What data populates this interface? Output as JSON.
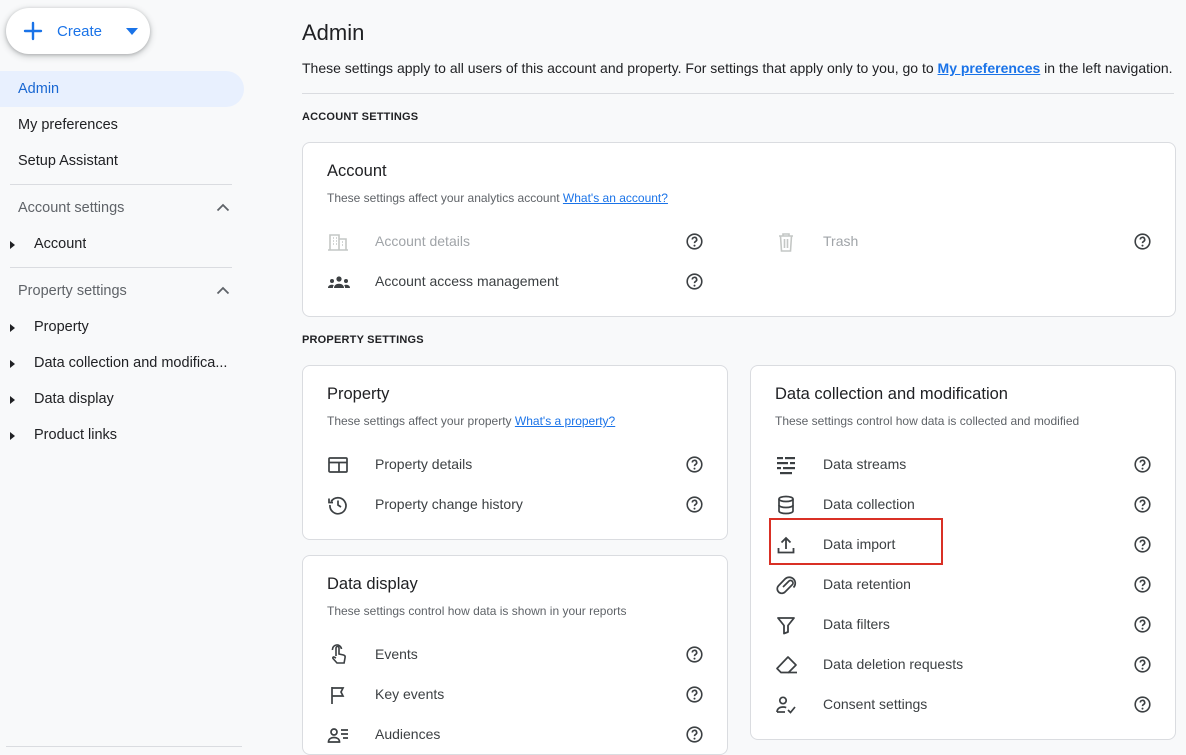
{
  "sidebar": {
    "create_label": "Create",
    "admin": "Admin",
    "my_preferences": "My preferences",
    "setup_assistant": "Setup Assistant",
    "account_settings_heading": "Account settings",
    "account_item": "Account",
    "property_settings_heading": "Property settings",
    "property_items": [
      "Property",
      "Data collection and modifica...",
      "Data display",
      "Product links"
    ]
  },
  "main": {
    "title": "Admin",
    "intro_text": "These settings apply to all users of this account and property. For settings that apply only to you, go to",
    "intro_link": "My preferences",
    "intro_suffix": "in the left navigation.",
    "account_settings_label": "ACCOUNT SETTINGS",
    "property_settings_label": "PROPERTY SETTINGS"
  },
  "cards": {
    "account": {
      "title": "Account",
      "subtitle": "These settings affect your analytics account",
      "link": "What's an account?",
      "rows": [
        {
          "label": "Account details",
          "icon": "building-icon",
          "disabled": true
        },
        {
          "label": "Trash",
          "icon": "trash-icon",
          "disabled": true
        },
        {
          "label": "Account access management",
          "icon": "group-icon",
          "disabled": false
        }
      ]
    },
    "property": {
      "title": "Property",
      "subtitle": "These settings affect your property",
      "link": "What's a property?",
      "rows": [
        {
          "label": "Property details",
          "icon": "web-icon"
        },
        {
          "label": "Property change history",
          "icon": "history-icon"
        }
      ]
    },
    "data_display": {
      "title": "Data display",
      "subtitle": "These settings control how data is shown in your reports",
      "rows": [
        {
          "label": "Events",
          "icon": "touch-icon"
        },
        {
          "label": "Key events",
          "icon": "flag-icon"
        },
        {
          "label": "Audiences",
          "icon": "audience-icon"
        }
      ]
    },
    "data_collection": {
      "title": "Data collection and modification",
      "subtitle": "These settings control how data is collected and modified",
      "rows": [
        {
          "label": "Data streams",
          "icon": "streams-icon"
        },
        {
          "label": "Data collection",
          "icon": "database-icon"
        },
        {
          "label": "Data import",
          "icon": "upload-icon"
        },
        {
          "label": "Data retention",
          "icon": "retention-icon"
        },
        {
          "label": "Data filters",
          "icon": "filter-icon"
        },
        {
          "label": "Data deletion requests",
          "icon": "eraser-icon"
        },
        {
          "label": "Consent settings",
          "icon": "consent-icon"
        }
      ]
    }
  },
  "colors": {
    "accent": "#1a73e8",
    "active_bg": "#e8f0fe",
    "highlight": "#d93025"
  }
}
